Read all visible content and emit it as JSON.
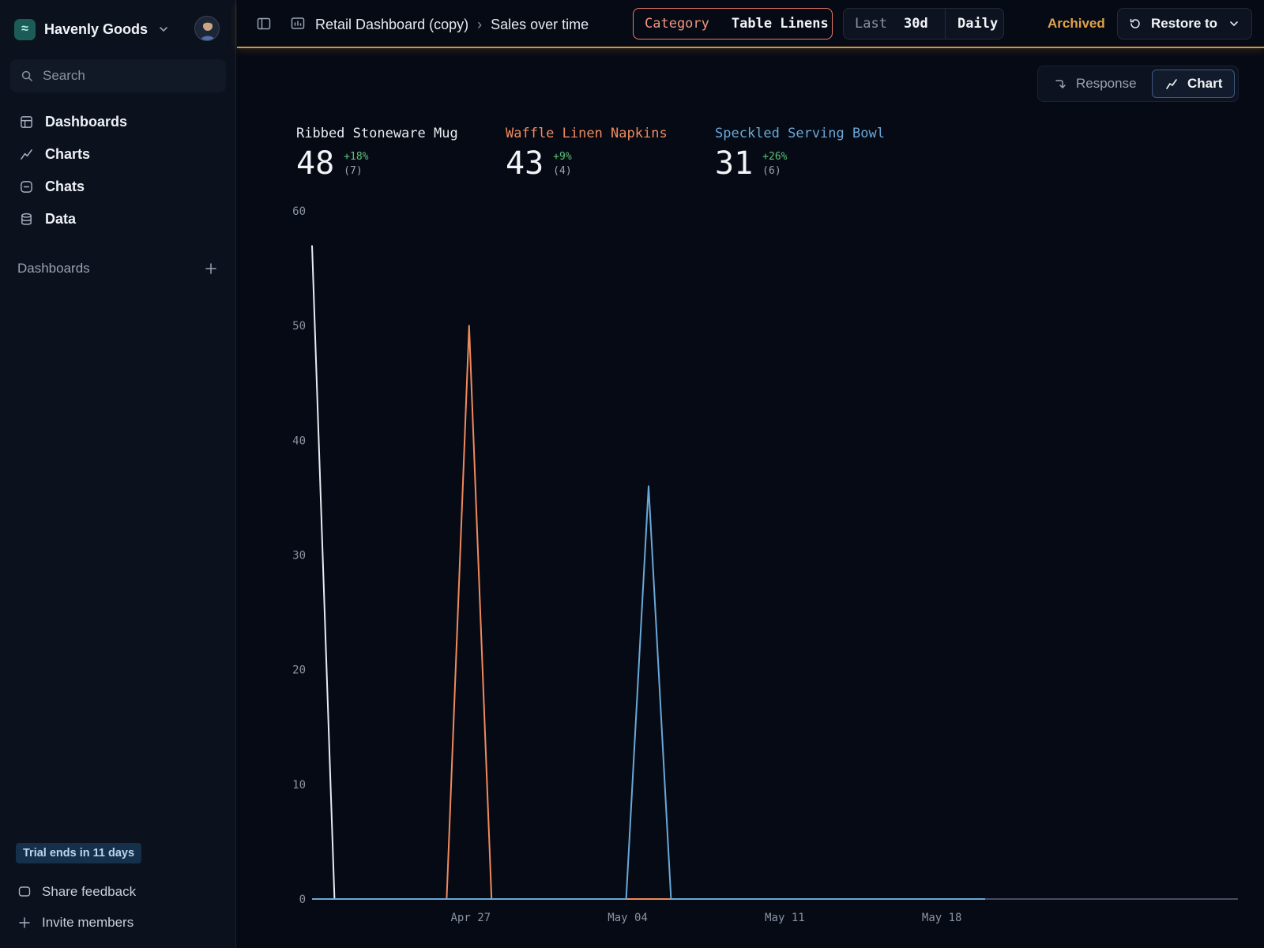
{
  "workspace": {
    "name": "Havenly Goods"
  },
  "sidebar": {
    "search_placeholder": "Search",
    "nav": [
      {
        "label": "Dashboards",
        "icon": "layout-icon"
      },
      {
        "label": "Charts",
        "icon": "chart-line-icon"
      },
      {
        "label": "Chats",
        "icon": "chat-icon"
      },
      {
        "label": "Data",
        "icon": "database-icon"
      }
    ],
    "section_label": "Dashboards",
    "trial": "Trial ends in 11 days",
    "share_feedback": "Share feedback",
    "invite_members": "Invite members"
  },
  "topbar": {
    "breadcrumb": [
      "Retail Dashboard (copy)",
      "Sales over time"
    ],
    "filter_key": "Category",
    "filter_value": "Table Linens",
    "range_label": "Last",
    "range_value": "30d",
    "granularity": "Daily",
    "status": "Archived",
    "restore_label": "Restore to",
    "accent_color": "#d4953a"
  },
  "view_toggle": {
    "response": "Response",
    "chart": "Chart",
    "active": "Chart"
  },
  "stats": [
    {
      "name": "Ribbed Stoneware Mug",
      "value": "48",
      "change": "+18%",
      "count": "(7)",
      "color": "#e8ebf0"
    },
    {
      "name": "Waffle Linen Napkins",
      "value": "43",
      "change": "+9%",
      "count": "(4)",
      "color": "#f08a5d"
    },
    {
      "name": "Speckled Serving Bowl",
      "value": "31",
      "change": "+26%",
      "count": "(6)",
      "color": "#6aa8d8"
    }
  ],
  "chart_data": {
    "type": "line",
    "x": [
      "Apr 20",
      "Apr 21",
      "Apr 22",
      "Apr 23",
      "Apr 24",
      "Apr 25",
      "Apr 26",
      "Apr 27",
      "Apr 28",
      "Apr 29",
      "Apr 30",
      "May 01",
      "May 02",
      "May 03",
      "May 04",
      "May 05",
      "May 06",
      "May 07",
      "May 08",
      "May 09",
      "May 10",
      "May 11",
      "May 12",
      "May 13",
      "May 14",
      "May 15",
      "May 16",
      "May 17",
      "May 18",
      "May 19",
      "May 20"
    ],
    "x_ticks": [
      "Apr 27",
      "May 04",
      "May 11",
      "May 18"
    ],
    "ylim": [
      0,
      60
    ],
    "y_ticks": [
      0,
      10,
      20,
      30,
      40,
      50,
      60
    ],
    "series": [
      {
        "name": "Ribbed Stoneware Mug",
        "color": "#e8ebf0",
        "values": [
          57,
          0,
          0,
          0,
          0,
          0,
          0,
          0,
          0,
          0,
          0,
          0,
          0,
          0,
          0,
          0,
          0,
          0,
          0,
          0,
          0,
          0,
          0,
          0,
          0,
          0,
          0,
          0,
          0,
          0,
          0
        ]
      },
      {
        "name": "Waffle Linen Napkins",
        "color": "#f08a5d",
        "values": [
          0,
          0,
          0,
          0,
          0,
          0,
          0,
          50,
          0,
          0,
          0,
          0,
          0,
          0,
          0,
          0,
          0,
          0,
          0,
          0,
          0,
          0,
          0,
          0,
          0,
          0,
          0,
          0,
          0,
          0,
          0
        ]
      },
      {
        "name": "Speckled Serving Bowl",
        "color": "#6aa8d8",
        "values": [
          0,
          0,
          0,
          0,
          0,
          0,
          0,
          0,
          0,
          0,
          0,
          0,
          0,
          0,
          0,
          36,
          0,
          0,
          0,
          0,
          0,
          0,
          0,
          0,
          0,
          0,
          0,
          0,
          0,
          0,
          0
        ]
      }
    ],
    "grid": false,
    "legend": "none"
  }
}
